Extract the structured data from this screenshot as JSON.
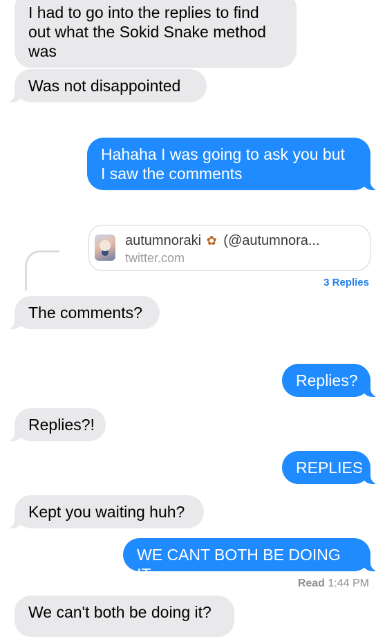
{
  "messages": [
    {
      "direction": "incoming",
      "text": "I had to go into the replies to find\nout what the Sokid Snake method\nwas"
    },
    {
      "direction": "incoming",
      "text": "Was not disappointed"
    },
    {
      "direction": "outgoing",
      "text": "Hahaha I was going to ask you but\nI saw the comments"
    },
    {
      "direction": "incoming",
      "text": "The comments?"
    },
    {
      "direction": "outgoing",
      "text": "Replies?"
    },
    {
      "direction": "incoming",
      "text": "Replies?!"
    },
    {
      "direction": "outgoing",
      "text": "REPLIES"
    },
    {
      "direction": "incoming",
      "text": "Kept you waiting huh?"
    },
    {
      "direction": "outgoing",
      "text": "WE CANT BOTH BE DOING IT"
    },
    {
      "direction": "incoming",
      "text": "We can't both be doing it?"
    }
  ],
  "link_preview": {
    "title_name": "autumnoraki",
    "title_emoji_icon": "leaf-icon",
    "title_handle": "(@autumnora...",
    "domain": "twitter.com",
    "replies_label": "3 Replies"
  },
  "read_receipt": {
    "label": "Read",
    "time": "1:44 PM"
  },
  "colors": {
    "incoming_bubble": "#e9e9eb",
    "outgoing_bubble": "#1f8bfe",
    "replies_link": "#1f7fe8",
    "receipt_text": "#8e8e93"
  }
}
